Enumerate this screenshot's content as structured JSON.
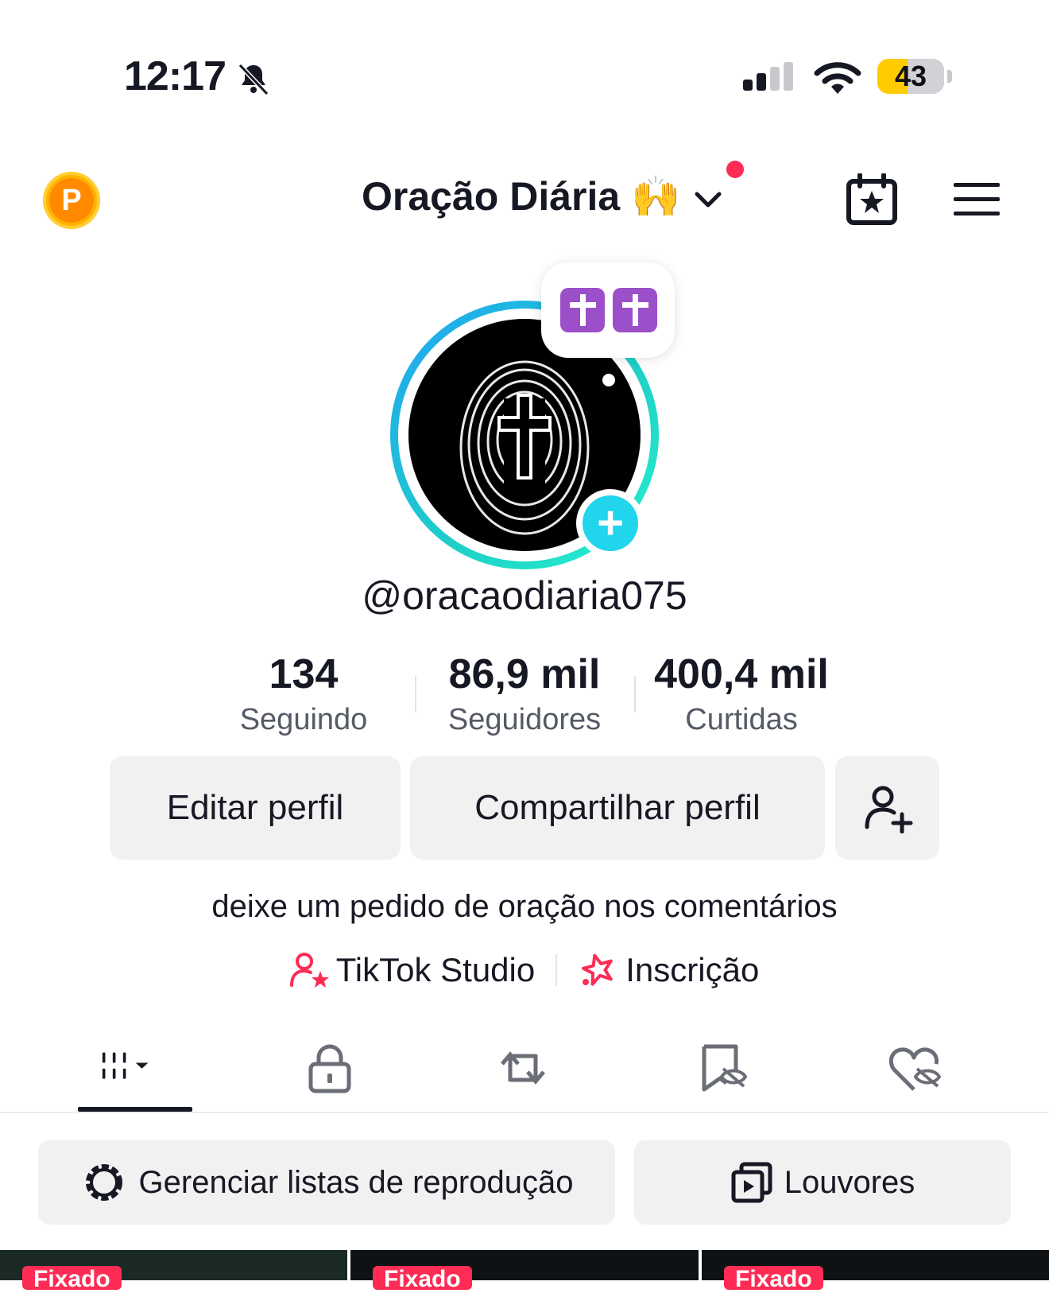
{
  "status_bar": {
    "time": "12:17",
    "battery": "43"
  },
  "header": {
    "title": "Oração Diária 🙌"
  },
  "avatar": {
    "note_emoji": "✝️✝️"
  },
  "profile": {
    "username": "@oracaodiaria075",
    "stats": [
      {
        "value": "134",
        "label": "Seguindo"
      },
      {
        "value": "86,9 mil",
        "label": "Seguidores"
      },
      {
        "value": "400,4 mil",
        "label": "Curtidas"
      }
    ],
    "buttons": {
      "edit": "Editar perfil",
      "share": "Compartilhar perfil"
    },
    "bio": "deixe um pedido de oração nos comentários",
    "links": {
      "studio": "TikTok Studio",
      "subscription": "Inscrição"
    }
  },
  "playlists": {
    "manage": "Gerenciar listas de reprodução",
    "louvores": "Louvores"
  },
  "videos": {
    "pinned_label": "Fixado"
  },
  "colors": {
    "accent": "#fe2c55",
    "teal": "#20d5ec",
    "coin": "#ff8a00",
    "battery": "#ffcc00"
  }
}
